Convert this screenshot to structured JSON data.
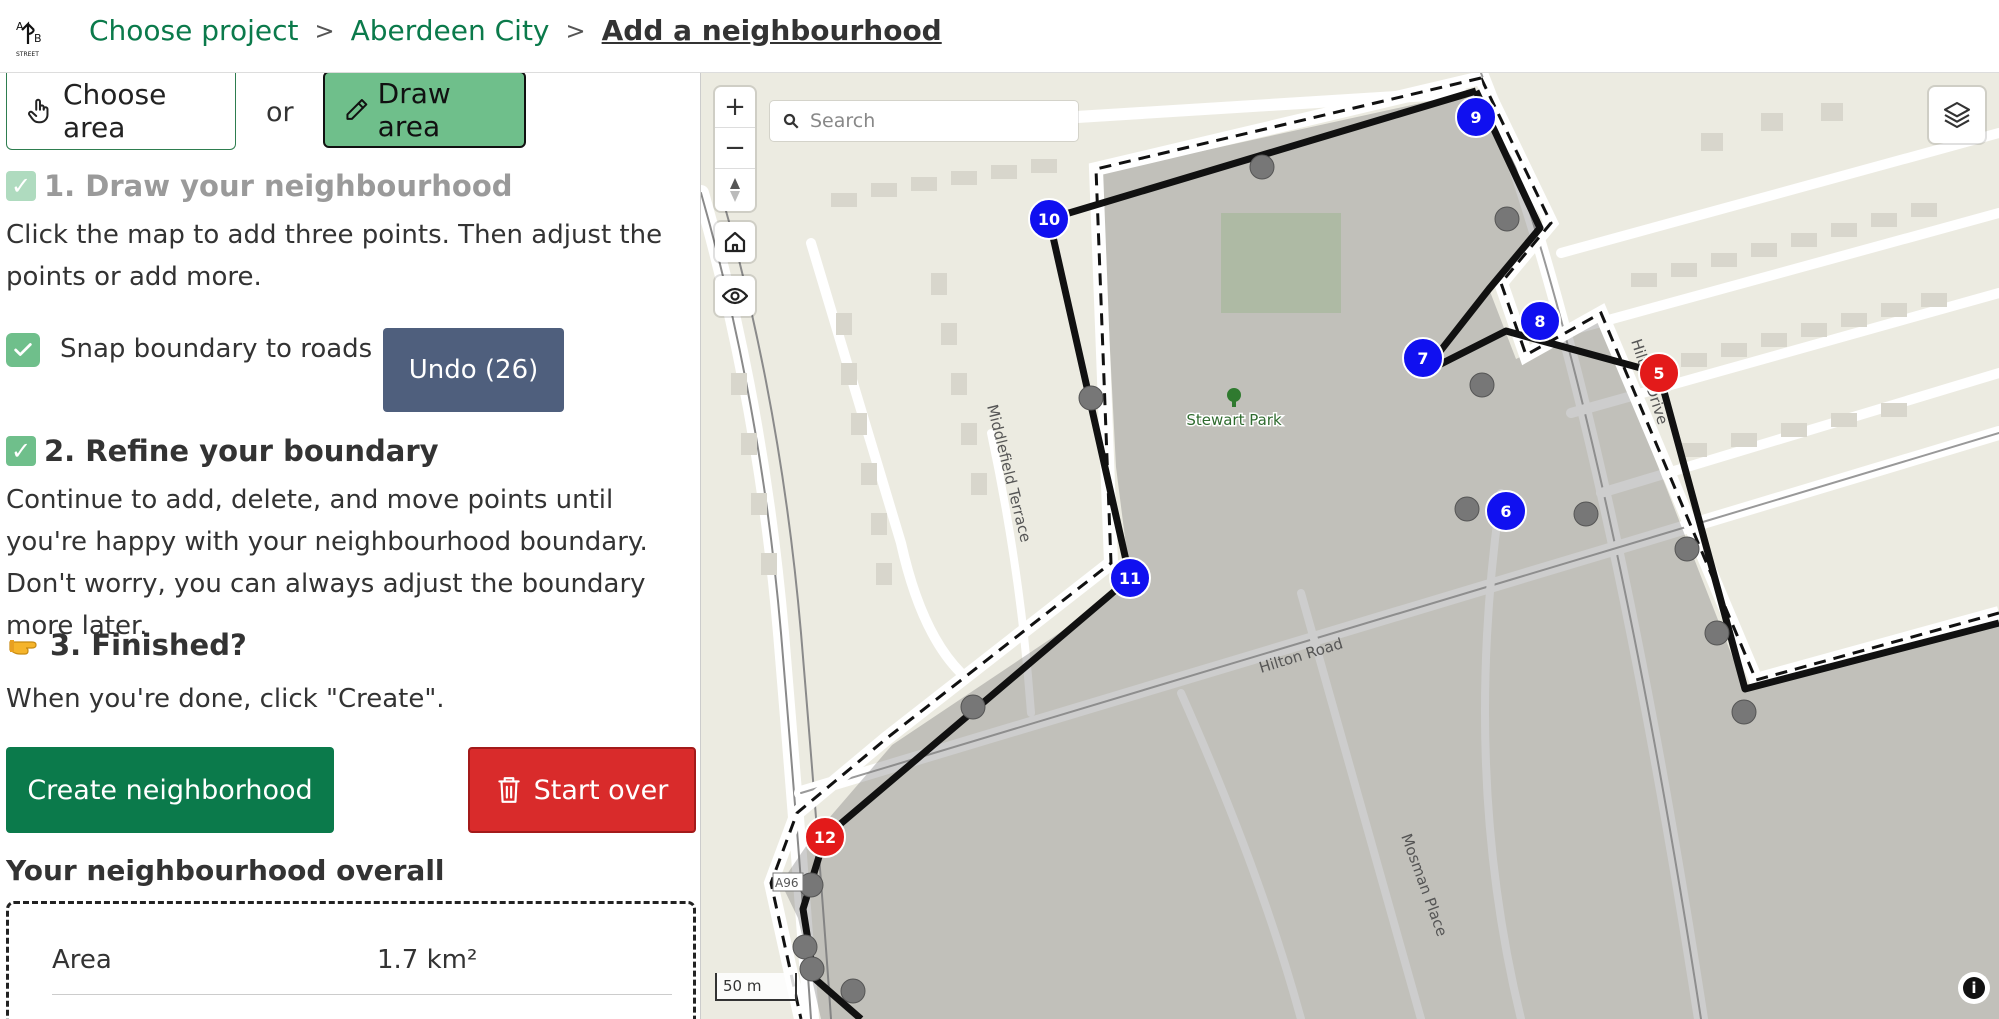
{
  "header": {
    "breadcrumbs": [
      {
        "label": "Choose project"
      },
      {
        "label": "Aberdeen City"
      }
    ],
    "separator": ">",
    "current": "Add a neighbourhood"
  },
  "mode": {
    "choose_label": "Choose area",
    "or_label": "or",
    "draw_label": "Draw area"
  },
  "steps": {
    "step1": {
      "check": "✓",
      "title": "1. Draw your neighbourhood",
      "text": "Click the map to add three points. Then adjust the points or add more."
    },
    "snap": {
      "checked": true,
      "label": "Snap boundary to roads"
    },
    "undo_label": "Undo (26)",
    "step2": {
      "check": "✓",
      "title": "2. Refine your boundary",
      "text": "Continue to add, delete, and move points until you're happy with your neighbourhood boundary. Don't worry, you can always adjust the boundary more later."
    },
    "step3": {
      "title": "3. Finished?",
      "text": "When you're done, click \"Create\"."
    }
  },
  "actions": {
    "create_label": "Create neighborhood",
    "start_over_label": "Start over"
  },
  "overall": {
    "title": "Your neighbourhood overall",
    "area_label": "Area",
    "area_value": "1.7 km²"
  },
  "map": {
    "search_placeholder": "Search",
    "zoom_in": "+",
    "zoom_out": "−",
    "scale_label": "50 m",
    "info": "i",
    "poi_label": "Stewart Park",
    "road_labels": {
      "hilton_drive": "Hilton Drive",
      "hilton_road": "Hilton Road",
      "middlefield": "Middlefield Terrace",
      "mosman": "Mosman Place",
      "a96": "A96"
    },
    "waypoints": [
      {
        "id": "5",
        "color": "#e31a1a"
      },
      {
        "id": "6",
        "color": "#1010f0"
      },
      {
        "id": "7",
        "color": "#1010f0"
      },
      {
        "id": "8",
        "color": "#1010f0"
      },
      {
        "id": "9",
        "color": "#1010f0"
      },
      {
        "id": "10",
        "color": "#1010f0"
      },
      {
        "id": "11",
        "color": "#1010f0"
      },
      {
        "id": "12",
        "color": "#e31a1a"
      }
    ]
  },
  "colors": {
    "brand_green": "#0b7a4b",
    "draw_active": "#6fbf8b",
    "undo": "#4f5f7d",
    "danger": "#d92b2b"
  }
}
